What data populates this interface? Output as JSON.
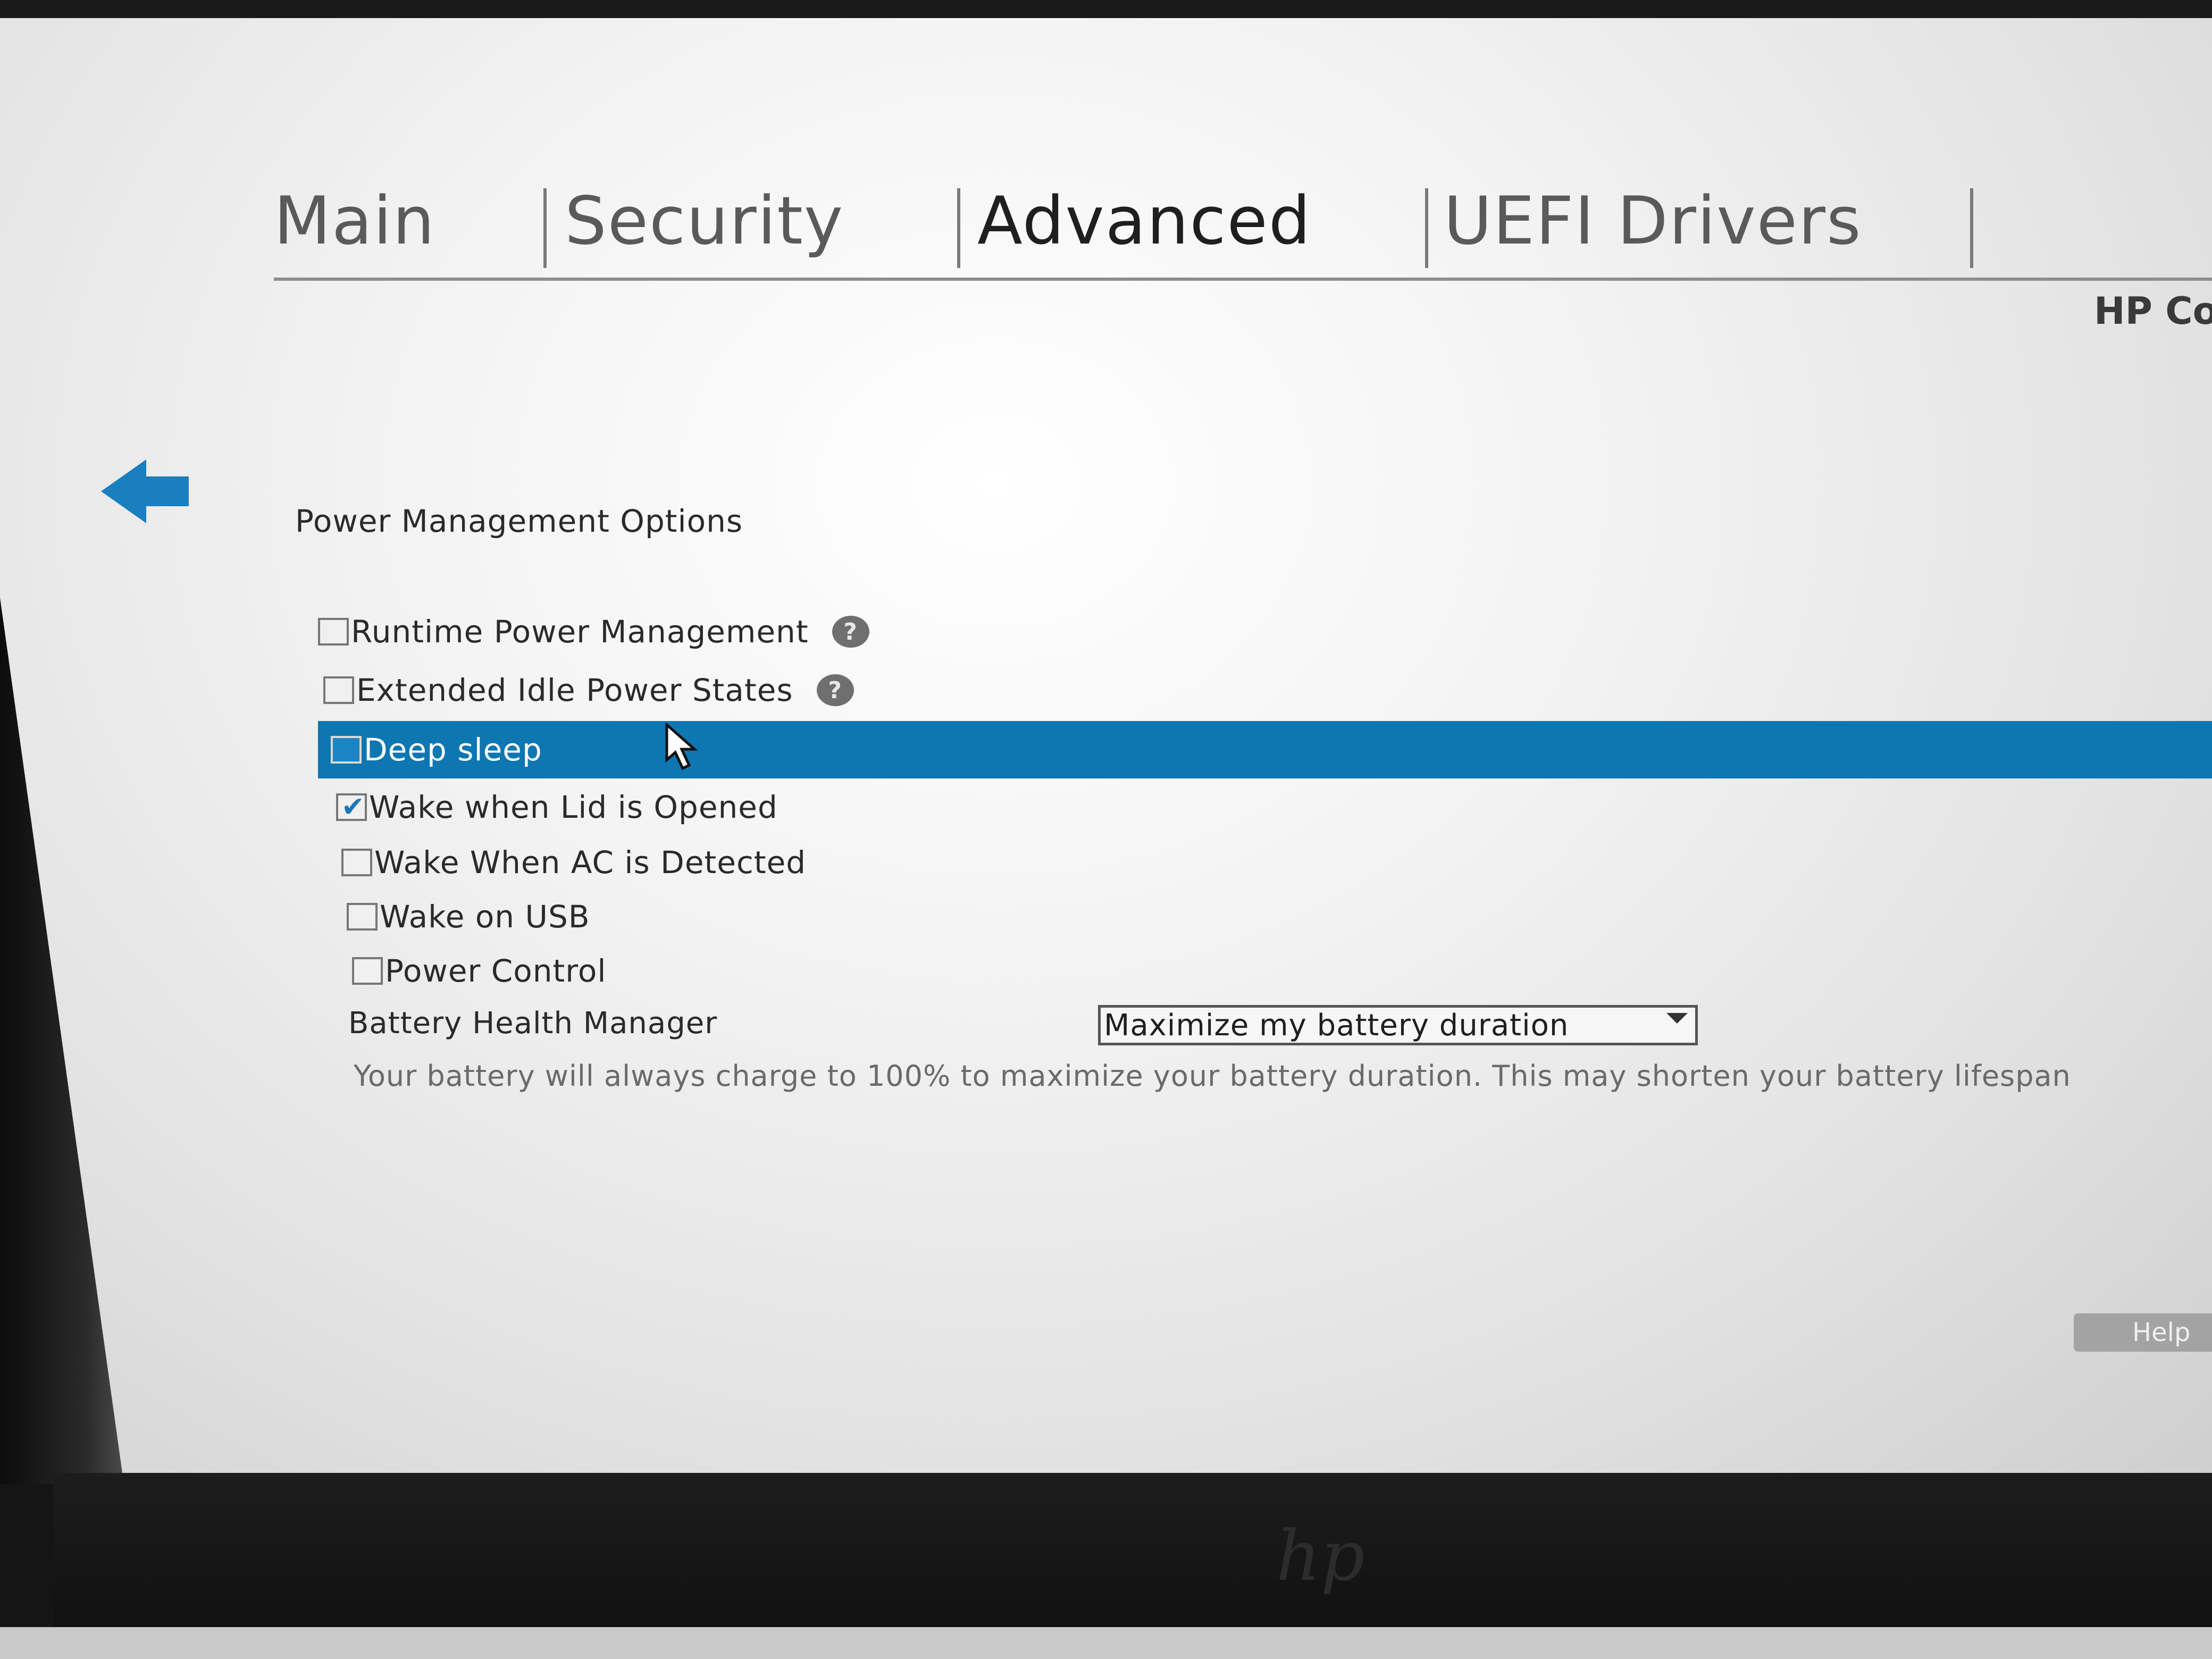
{
  "tabs": [
    {
      "label": "Main",
      "active": false
    },
    {
      "label": "Security",
      "active": false
    },
    {
      "label": "Advanced",
      "active": true
    },
    {
      "label": "UEFI Drivers",
      "active": false
    }
  ],
  "brand": "HP Con",
  "section_title": "Power Management Options",
  "options": [
    {
      "label": "Runtime Power Management",
      "checked": false,
      "has_help": true
    },
    {
      "label": "Extended Idle Power States",
      "checked": false,
      "has_help": true
    },
    {
      "label": "Deep sleep",
      "checked": false,
      "selected": true
    },
    {
      "label": "Wake when Lid is Opened",
      "checked": true
    },
    {
      "label": "Wake When AC is Detected",
      "checked": false
    },
    {
      "label": "Wake on USB",
      "checked": false
    },
    {
      "label": "Power Control",
      "checked": false
    }
  ],
  "help_icon_glyph": "?",
  "battery_health": {
    "label": "Battery Health Manager",
    "value": "Maximize my battery duration",
    "description": "Your battery will always charge to 100% to maximize your battery duration. This may shorten your battery lifespan"
  },
  "help_button": "Help",
  "bezel_logo": "hp",
  "colors": {
    "selection": "#0e76b0",
    "accent_arrow": "#1a7fbf"
  }
}
